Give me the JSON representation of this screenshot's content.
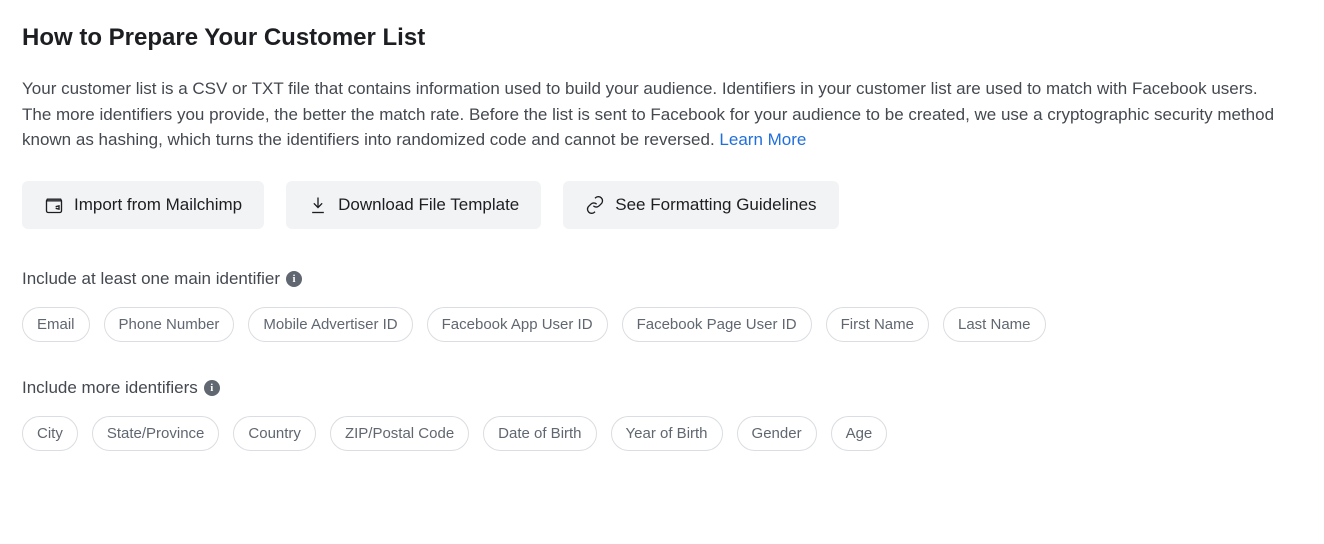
{
  "title": "How to Prepare Your Customer List",
  "description": "Your customer list is a CSV or TXT file that contains information used to build your audience. Identifiers in your customer list are used to match with Facebook users. The more identifiers you provide, the better the match rate. Before the list is sent to Facebook for your audience to be created, we use a cryptographic security method known as hashing, which turns the identifiers into randomized code and cannot be reversed. ",
  "learn_more_label": "Learn More",
  "actions": {
    "mailchimp": "Import from Mailchimp",
    "download_template": "Download File Template",
    "formatting_guidelines": "See Formatting Guidelines"
  },
  "sections": {
    "main_identifiers": {
      "label": "Include at least one main identifier",
      "chips": [
        "Email",
        "Phone Number",
        "Mobile Advertiser ID",
        "Facebook App User ID",
        "Facebook Page User ID",
        "First Name",
        "Last Name"
      ]
    },
    "more_identifiers": {
      "label": "Include more identifiers",
      "chips": [
        "City",
        "State/Province",
        "Country",
        "ZIP/Postal Code",
        "Date of Birth",
        "Year of Birth",
        "Gender",
        "Age"
      ]
    }
  }
}
